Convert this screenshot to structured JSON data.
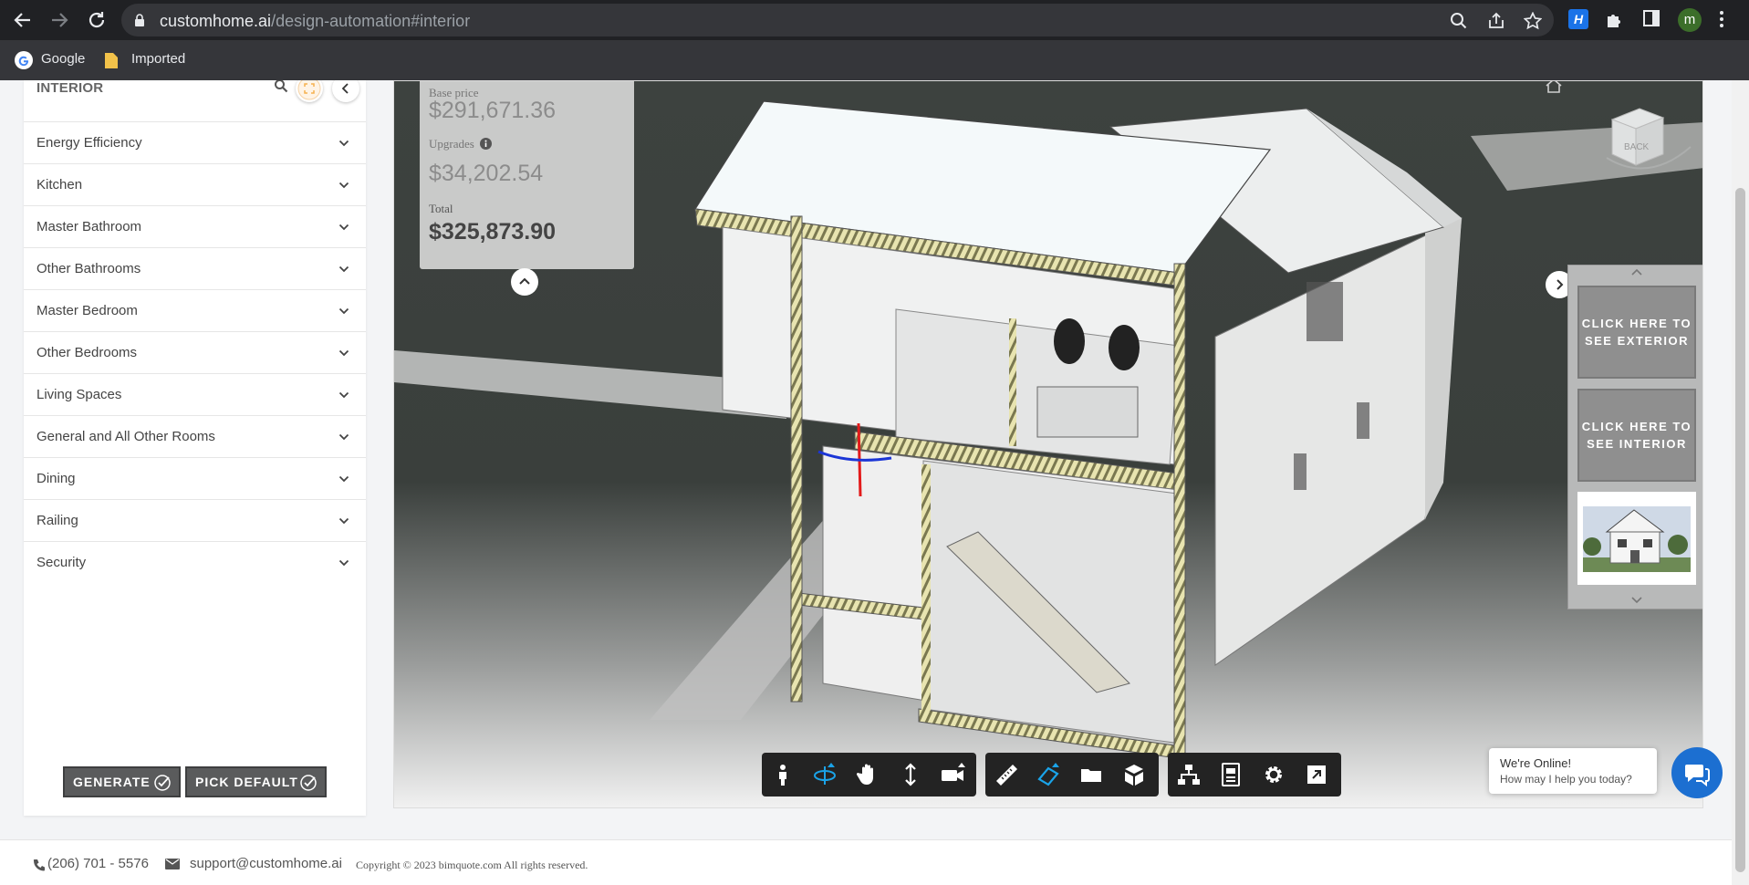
{
  "browser": {
    "url_domain": "customhome.ai",
    "url_path": "/design-automation#interior",
    "avatar_letter": "m",
    "bookmarks": [
      {
        "label": "Google",
        "icon": "google-icon"
      },
      {
        "label": "Imported",
        "icon": "folder-icon"
      }
    ]
  },
  "sidebar": {
    "title": "INTERIOR",
    "items": [
      {
        "label": "Energy Efficiency"
      },
      {
        "label": "Kitchen"
      },
      {
        "label": "Master Bathroom"
      },
      {
        "label": "Other Bathrooms"
      },
      {
        "label": "Master Bedroom"
      },
      {
        "label": "Other Bedrooms"
      },
      {
        "label": "Living Spaces"
      },
      {
        "label": "General and All Other Rooms"
      },
      {
        "label": "Dining"
      },
      {
        "label": "Railing"
      },
      {
        "label": "Security"
      }
    ],
    "generate_label": "GENERATE",
    "pick_default_label": "PICK DEFAULT"
  },
  "price": {
    "base_label": "Base price",
    "base_value": "$291,671.36",
    "upgrades_label": "Upgrades",
    "upgrades_value": "$34,202.54",
    "total_label": "Total",
    "total_value": "$325,873.90"
  },
  "viewcube_label": "BACK",
  "gallery": {
    "exterior_label": "CLICK HERE TO SEE EXTERIOR",
    "interior_label": "CLICK HERE TO SEE INTERIOR"
  },
  "toolbar": {
    "groups": [
      [
        "walk-icon",
        "orbit-icon",
        "pan-icon",
        "zoom-icon",
        "camera-icon"
      ],
      [
        "measure-icon",
        "section-icon",
        "explode-icon",
        "model-icon"
      ],
      [
        "model-browser-icon",
        "properties-icon",
        "settings-icon",
        "fullscreen-icon"
      ]
    ],
    "accent": "#1aa3e8"
  },
  "footer": {
    "phone": "(206) 701 - 5576",
    "email": "support@customhome.ai",
    "copyright": "Copyright © 2023 bimquote.com All rights reserved."
  },
  "chat": {
    "title": "We're Online!",
    "subtitle": "How may I help you today?",
    "button_color": "#1c6fd1"
  }
}
